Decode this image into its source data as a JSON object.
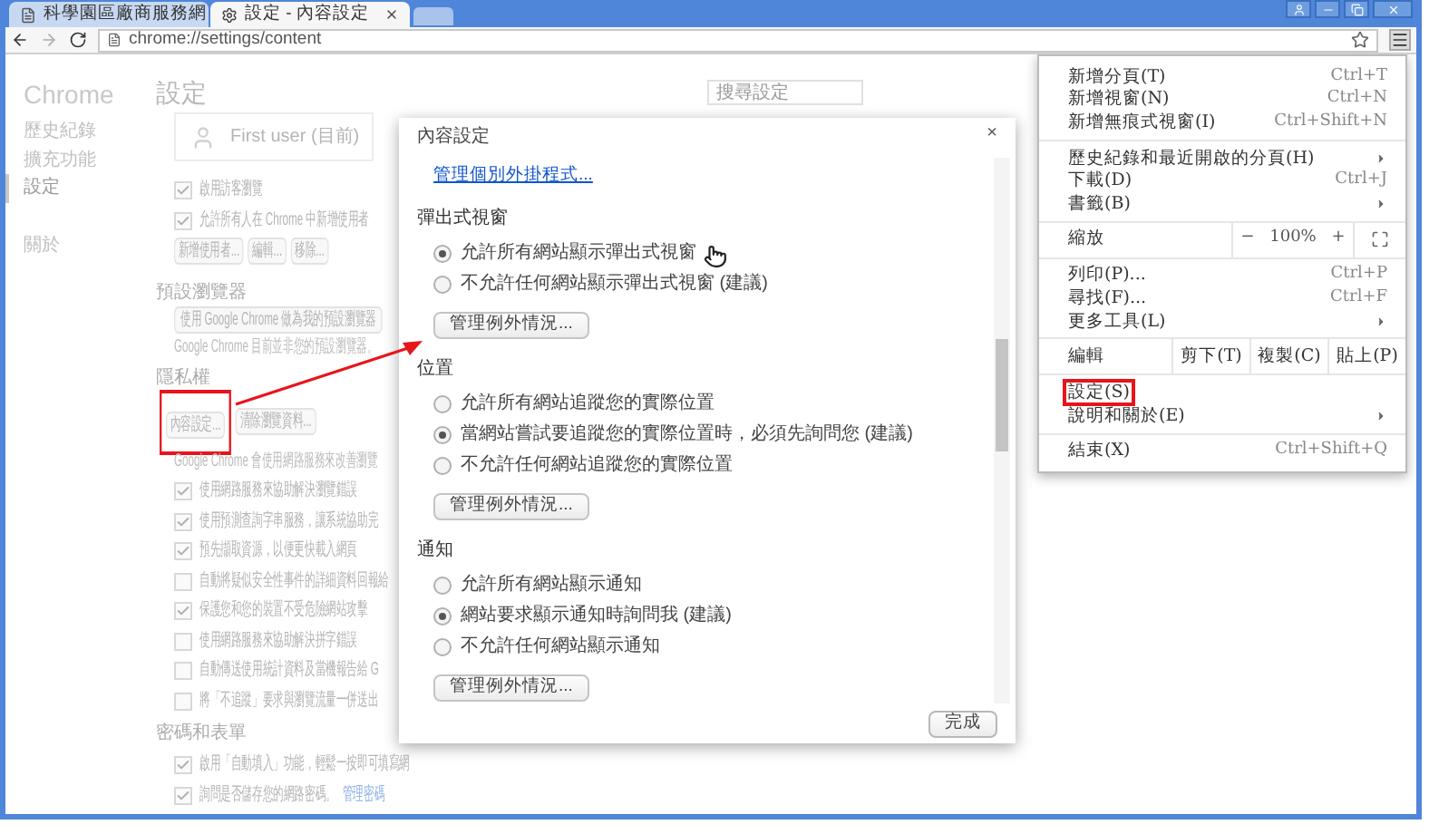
{
  "tabs": [
    {
      "title": "科學園區廠商服務網",
      "kind": "page",
      "selected": false
    },
    {
      "title": "設定 - 內容設定",
      "kind": "gear",
      "selected": true
    }
  ],
  "address": "chrome://settings/content",
  "settings": {
    "brand": "Chrome",
    "sidebar": [
      {
        "label": "歷史紀錄",
        "selected": false
      },
      {
        "label": "擴充功能",
        "selected": false
      },
      {
        "label": "設定",
        "selected": true
      },
      {
        "label": "關於",
        "selected": false
      }
    ],
    "title": "設定",
    "search": {
      "placeholder": "搜尋設定"
    },
    "profile": "First user (目前)",
    "users_options": [
      {
        "label": "啟用訪客瀏覽",
        "checked": true
      },
      {
        "label": "允許所有人在 Chrome 中新增使用者",
        "checked": true
      }
    ],
    "users_buttons": [
      "新增使用者...",
      "編輯...",
      "移除..."
    ],
    "default_browser": {
      "heading": "預設瀏覽器",
      "button": "使用 Google Chrome 做為我的預設瀏覽器",
      "note": "Google Chrome 目前並非您的預設瀏覽器。"
    },
    "privacy": {
      "heading": "隱私權",
      "buttons": [
        {
          "label": "內容設定...",
          "highlighted": true
        },
        {
          "label": "清除瀏覽資料...",
          "highlighted": false
        }
      ],
      "note": "Google Chrome 會使用網路服務來改善瀏覽",
      "options": [
        {
          "label": "使用網路服務來協助解決瀏覽錯誤",
          "checked": true
        },
        {
          "label": "使用預測查詢字串服務，讓系統協助完",
          "checked": true
        },
        {
          "label": "預先擷取資源，以便更快載入網頁",
          "checked": true
        },
        {
          "label": "自動將疑似安全性事件的詳細資料回報給",
          "checked": false
        },
        {
          "label": "保護您和您的裝置不受危險網站攻擊",
          "checked": true
        },
        {
          "label": "使用網路服務來協助解決拼字錯誤",
          "checked": false
        },
        {
          "label": "自動傳送使用統計資料及當機報告給 G",
          "checked": false
        },
        {
          "label": "將「不追蹤」要求與瀏覽流量一併送出",
          "checked": false
        }
      ]
    },
    "passwords": {
      "heading": "密碼和表單",
      "options": [
        {
          "label": "啟用「自動填入」功能，輕鬆一按即可填寫網",
          "checked": true
        },
        {
          "label": "詢問是否儲存您的網路密碼。",
          "checked": true,
          "link": "管理密碼"
        }
      ]
    }
  },
  "dialog": {
    "title": "內容設定",
    "close": "×",
    "plugins_link": "管理個別外掛程式...",
    "sections": [
      {
        "heading": "彈出式視窗",
        "options": [
          {
            "label": "允許所有網站顯示彈出式視窗",
            "selected": true
          },
          {
            "label": "不允許任何網站顯示彈出式視窗 (建議)",
            "selected": false
          }
        ],
        "button": "管理例外情況..."
      },
      {
        "heading": "位置",
        "options": [
          {
            "label": "允許所有網站追蹤您的實際位置",
            "selected": false
          },
          {
            "label": "當網站嘗試要追蹤您的實際位置時，必須先詢問您 (建議)",
            "selected": true
          },
          {
            "label": "不允許任何網站追蹤您的實際位置",
            "selected": false
          }
        ],
        "button": "管理例外情況..."
      },
      {
        "heading": "通知",
        "options": [
          {
            "label": "允許所有網站顯示通知",
            "selected": false
          },
          {
            "label": "網站要求顯示通知時詢問我 (建議)",
            "selected": true
          },
          {
            "label": "不允許任何網站顯示通知",
            "selected": false
          }
        ],
        "button": "管理例外情況..."
      }
    ],
    "done": "完成"
  },
  "menu": {
    "groups": [
      [
        {
          "kind": "item",
          "label": "新增分頁(T)",
          "shortcut": "Ctrl+T"
        },
        {
          "kind": "item",
          "label": "新增視窗(N)",
          "shortcut": "Ctrl+N"
        },
        {
          "kind": "item",
          "label": "新增無痕式視窗(I)",
          "shortcut": "Ctrl+Shift+N"
        }
      ],
      [
        {
          "kind": "submenu",
          "label": "歷史紀錄和最近開啟的分頁(H)"
        },
        {
          "kind": "item",
          "label": "下載(D)",
          "shortcut": "Ctrl+J"
        },
        {
          "kind": "submenu",
          "label": "書籤(B)"
        }
      ],
      [
        {
          "kind": "zoom",
          "label": "縮放",
          "minus": "−",
          "value": "100%",
          "plus": "+"
        }
      ],
      [
        {
          "kind": "item",
          "label": "列印(P)...",
          "shortcut": "Ctrl+P"
        },
        {
          "kind": "item",
          "label": "尋找(F)...",
          "shortcut": "Ctrl+F"
        },
        {
          "kind": "submenu",
          "label": "更多工具(L)"
        }
      ],
      [
        {
          "kind": "edit",
          "label": "編輯",
          "actions": [
            "剪下(T)",
            "複製(C)",
            "貼上(P)"
          ]
        }
      ],
      [
        {
          "kind": "item",
          "label": "設定(S)",
          "highlighted": true
        },
        {
          "kind": "submenu",
          "label": "說明和關於(E)"
        }
      ],
      [
        {
          "kind": "item",
          "label": "結束(X)",
          "shortcut": "Ctrl+Shift+Q"
        }
      ]
    ]
  }
}
